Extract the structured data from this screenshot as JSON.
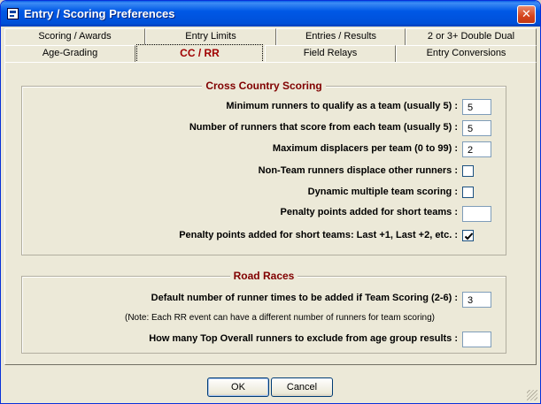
{
  "window": {
    "title": "Entry / Scoring Preferences",
    "close_label": "✕"
  },
  "tabs": {
    "row1": [
      {
        "label": "Scoring / Awards"
      },
      {
        "label": "Entry Limits"
      },
      {
        "label": "Entries / Results"
      },
      {
        "label": "2 or 3+ Double Dual"
      }
    ],
    "row2": [
      {
        "label": "Age-Grading"
      },
      {
        "label": "CC / RR",
        "active": true
      },
      {
        "label": "Field Relays"
      },
      {
        "label": "Entry Conversions"
      }
    ]
  },
  "cross_country": {
    "title": "Cross Country Scoring",
    "rows": [
      {
        "label": "Minimum runners to qualify as a team (usually 5) :",
        "type": "text",
        "value": "5"
      },
      {
        "label": "Number of runners that score from each team (usually 5) :",
        "type": "text",
        "value": "5"
      },
      {
        "label": "Maximum displacers per team (0 to 99) :",
        "type": "text",
        "value": "2"
      },
      {
        "label": "Non-Team runners displace other runners :",
        "type": "checkbox",
        "checked": false
      },
      {
        "label": "Dynamic multiple team scoring :",
        "type": "checkbox",
        "checked": false
      },
      {
        "label": "Penalty points added for short teams :",
        "type": "text",
        "value": ""
      },
      {
        "label": "Penalty points added for short teams: Last +1, Last +2, etc. :",
        "type": "checkbox",
        "checked": true
      }
    ]
  },
  "road_races": {
    "title": "Road Races",
    "default_times_label": "Default number of runner times to be added if Team Scoring (2-6) :",
    "default_times_value": "3",
    "note": "(Note: Each RR event can have a different number of runners for team scoring)",
    "exclude_label": "How many Top Overall runners to exclude from age group results :",
    "exclude_value": ""
  },
  "buttons": {
    "ok": "OK",
    "cancel": "Cancel"
  }
}
